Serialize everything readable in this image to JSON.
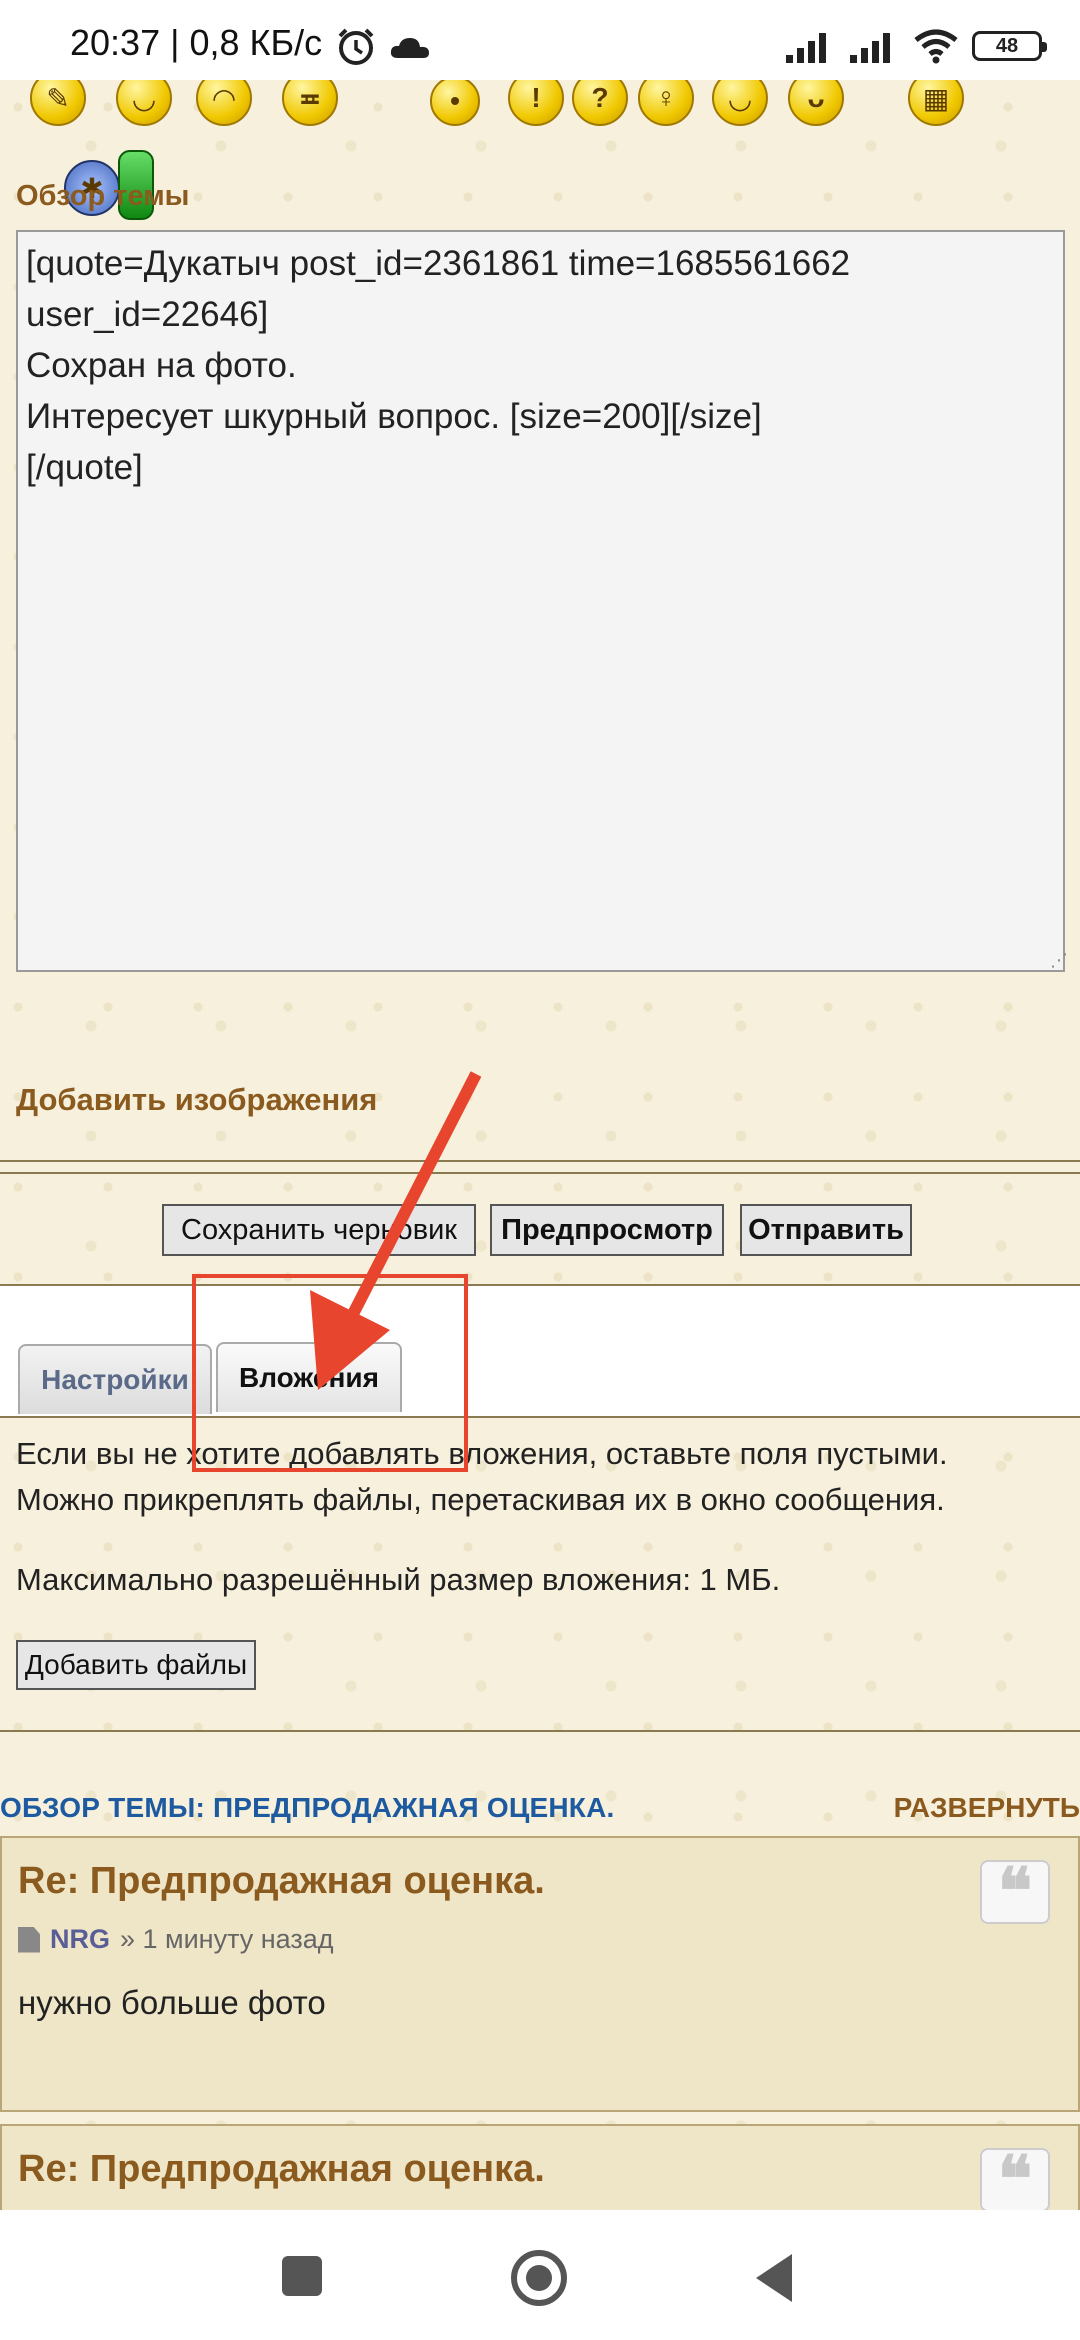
{
  "status_bar": {
    "time": "20:37 | 0,8 КБ/с",
    "battery": "48",
    "icons": [
      "alarm-icon",
      "cloud-icon",
      "signal-icon",
      "signal-icon",
      "wifi-icon",
      "battery-icon"
    ]
  },
  "editor": {
    "section_title": "Обзор темы",
    "content": "[quote=Дукатыч post_id=2361861 time=1685561662\nuser_id=22646]\nСохран на фото.\nИнтересует шкурный вопрос. [size=200][/size]\n[/quote]",
    "add_images_label": "Добавить изображения"
  },
  "actions": {
    "save_draft": "Сохранить черновик",
    "preview": "Предпросмотр",
    "submit": "Отправить"
  },
  "tabs": [
    {
      "label": "Настройки",
      "active": false
    },
    {
      "label": "Вложения",
      "active": true
    }
  ],
  "attachments": {
    "line1": "Если вы не хотите добавлять вложения, оставьте поля пустыми.",
    "line2": "Можно прикреплять файлы, перетаскивая их в окно сообщения.",
    "max_size": "Максимально разрешённый размер вложения: 1 МБ.",
    "add_files": "Добавить файлы"
  },
  "topic_review": {
    "title": "ОБЗОР ТЕМЫ: ПРЕДПРОДАЖНАЯ ОЦЕНКА.",
    "expand": "РАЗВЕРНУТЬ"
  },
  "posts": [
    {
      "title": "Re: Предпродажная оценка.",
      "author": "NRG",
      "time": "» 1 минуту назад",
      "body": "нужно больше фото"
    },
    {
      "title": "Re: Предпродажная оценка."
    }
  ],
  "colors": {
    "background": "#f6f0dc",
    "accent_brown": "#8a5a1e",
    "review_blue": "#1d5aa0",
    "annotation_red": "#e8452f"
  }
}
